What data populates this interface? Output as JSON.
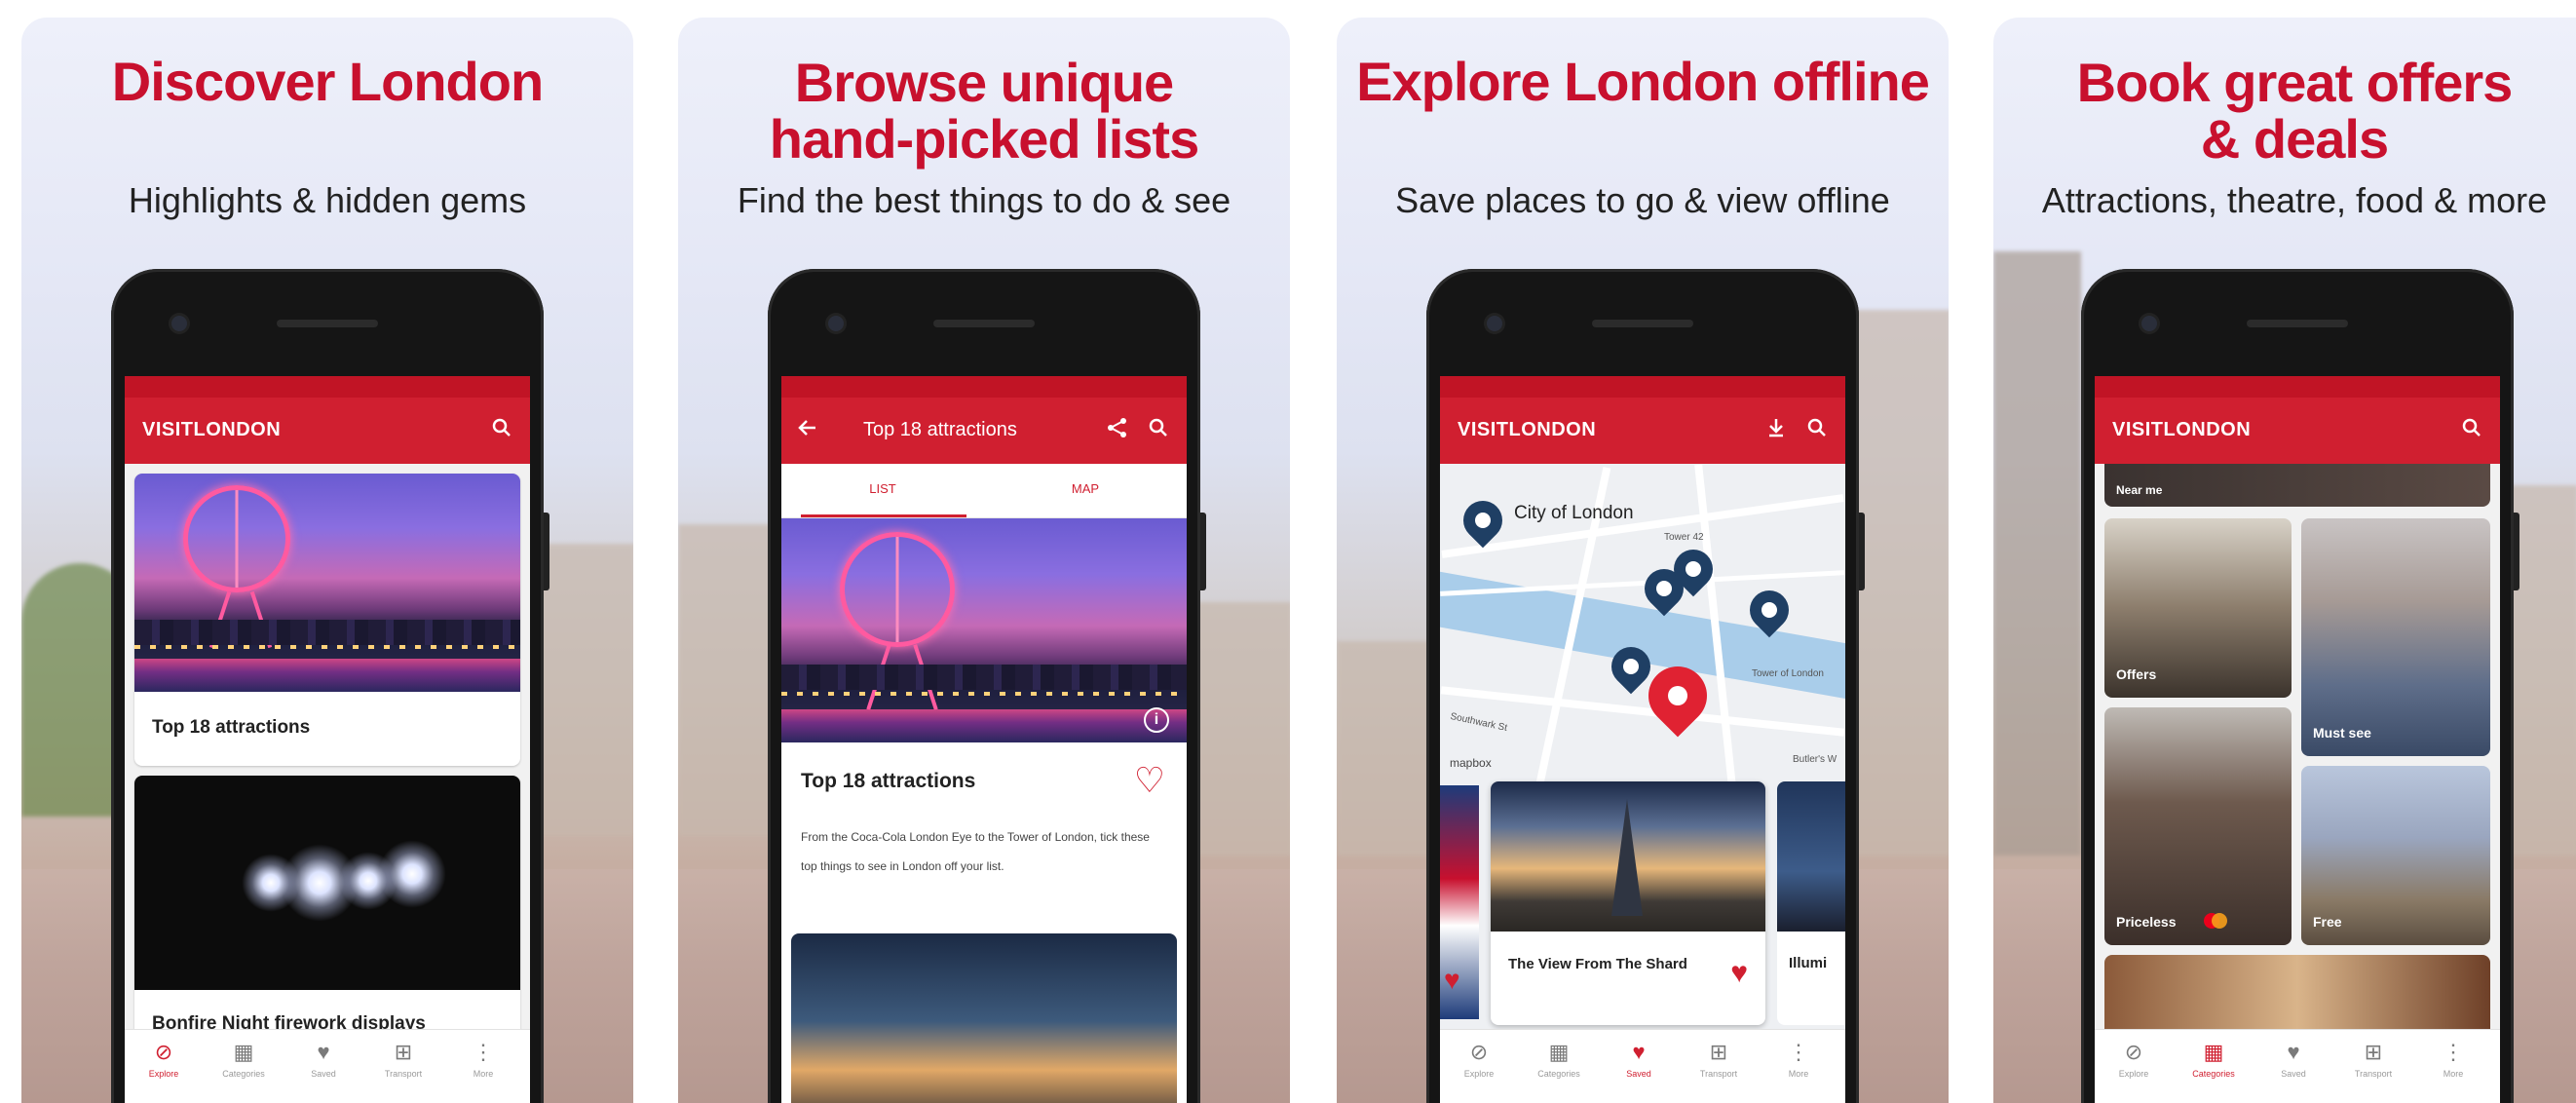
{
  "brand_color": "#c8102e",
  "cards": [
    {
      "headline": "Discover London",
      "subtitle": "Highlights & hidden gems",
      "app_bar": {
        "brand": "VISITLONDON",
        "icons": [
          "search-icon"
        ]
      },
      "tiles": [
        {
          "caption": "Top 18 attractions"
        },
        {
          "caption": "Bonfire Night firework displays"
        }
      ],
      "nav": [
        {
          "label": "Explore",
          "icon": "compass-icon",
          "active": true
        },
        {
          "label": "Categories",
          "icon": "grid-icon",
          "active": false
        },
        {
          "label": "Saved",
          "icon": "heart-icon",
          "active": false
        },
        {
          "label": "Transport",
          "icon": "train-icon",
          "active": false
        },
        {
          "label": "More",
          "icon": "more-icon",
          "active": false
        }
      ]
    },
    {
      "headline_line1": "Browse unique",
      "headline_line2": "hand-picked lists",
      "subtitle": "Find the best things to do & see",
      "app_bar": {
        "title": "Top 18 attractions",
        "icons": [
          "back-arrow-icon",
          "share-icon",
          "search-icon"
        ]
      },
      "tabs": [
        "LIST",
        "MAP"
      ],
      "detail_title": "Top 18 attractions",
      "detail_body": "From the Coca-Cola London Eye to the Tower of London, tick these top things to see in London off your list."
    },
    {
      "headline": "Explore London offline",
      "subtitle": "Save places to go & view offline",
      "app_bar": {
        "brand": "VISITLONDON",
        "icons": [
          "download-icon",
          "search-icon"
        ]
      },
      "map": {
        "city_label": "City of London",
        "small_labels": [
          "Tower 42",
          "Tower of London",
          "Southwark St",
          "Butler's W"
        ],
        "attribution": "mapbox"
      },
      "carousel": {
        "card_title": "The View From The Shard",
        "peek_title": "Illumi"
      },
      "nav": [
        {
          "label": "Explore",
          "icon": "compass-icon",
          "active": false
        },
        {
          "label": "Categories",
          "icon": "grid-icon",
          "active": false
        },
        {
          "label": "Saved",
          "icon": "heart-icon",
          "active": true
        },
        {
          "label": "Transport",
          "icon": "train-icon",
          "active": false
        },
        {
          "label": "More",
          "icon": "more-icon",
          "active": false
        }
      ]
    },
    {
      "headline_line1": "Book great offers",
      "headline_line2": "& deals",
      "subtitle": "Attractions, theatre, food & more",
      "app_bar": {
        "brand": "VISITLONDON",
        "icons": [
          "search-icon"
        ]
      },
      "top_strip": "Near me",
      "grid": [
        {
          "label": "Offers"
        },
        {
          "label": "Must see"
        },
        {
          "label": "Priceless"
        },
        {
          "label": "Free"
        }
      ],
      "nav": [
        {
          "label": "Explore",
          "icon": "compass-icon",
          "active": false
        },
        {
          "label": "Categories",
          "icon": "grid-icon",
          "active": true
        },
        {
          "label": "Saved",
          "icon": "heart-icon",
          "active": false
        },
        {
          "label": "Transport",
          "icon": "train-icon",
          "active": false
        },
        {
          "label": "More",
          "icon": "more-icon",
          "active": false
        }
      ]
    }
  ]
}
